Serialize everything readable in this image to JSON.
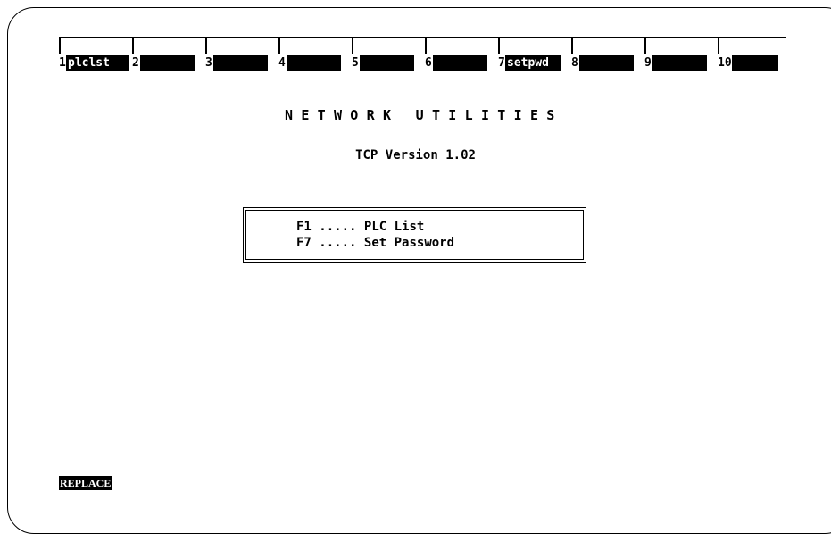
{
  "fkeys": [
    {
      "num": "1",
      "label": "plclst"
    },
    {
      "num": "2",
      "label": ""
    },
    {
      "num": "3",
      "label": ""
    },
    {
      "num": "4",
      "label": ""
    },
    {
      "num": "5",
      "label": ""
    },
    {
      "num": "6",
      "label": ""
    },
    {
      "num": "7",
      "label": "setpwd"
    },
    {
      "num": "8",
      "label": ""
    },
    {
      "num": "9",
      "label": ""
    },
    {
      "num": "10",
      "label": ""
    }
  ],
  "header": {
    "title": "NETWORK UTILITIES",
    "version": "TCP Version 1.02"
  },
  "menu": {
    "lines": [
      {
        "key": "F1",
        "dots": ".....",
        "label": "PLC List"
      },
      {
        "key": "F7",
        "dots": ".....",
        "label": "Set Password"
      }
    ]
  },
  "status": {
    "mode": "REPLACE"
  }
}
